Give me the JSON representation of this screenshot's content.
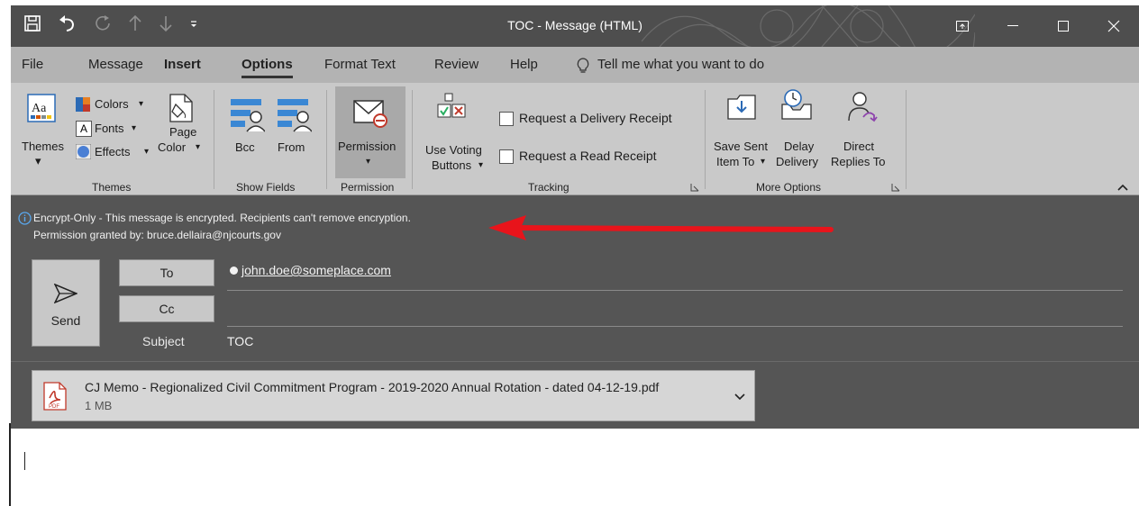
{
  "window": {
    "title": "TOC  -  Message (HTML)"
  },
  "tabs": [
    {
      "label": "File"
    },
    {
      "label": "Message"
    },
    {
      "label": "Insert"
    },
    {
      "label": "Options"
    },
    {
      "label": "Format Text"
    },
    {
      "label": "Review"
    },
    {
      "label": "Help"
    }
  ],
  "tell_me": "Tell me what you want to do",
  "ribbon": {
    "themes": {
      "themes_label": "Themes",
      "colors_label": "Colors",
      "fonts_label": "Fonts",
      "effects_label": "Effects",
      "page_color_label_1": "Page",
      "page_color_label_2": "Color",
      "group_label": "Themes"
    },
    "show_fields": {
      "bcc_label": "Bcc",
      "from_label": "From",
      "group_label": "Show Fields"
    },
    "permission": {
      "permission_label": "Permission",
      "group_label": "Permission"
    },
    "tracking": {
      "voting_label_1": "Use Voting",
      "voting_label_2": "Buttons",
      "delivery_receipt_label": "Request a Delivery Receipt",
      "read_receipt_label": "Request a Read Receipt",
      "group_label": "Tracking"
    },
    "more_options": {
      "save_sent_label_1": "Save Sent",
      "save_sent_label_2": "Item To",
      "delay_label_1": "Delay",
      "delay_label_2": "Delivery",
      "direct_label_1": "Direct",
      "direct_label_2": "Replies To",
      "group_label": "More Options"
    }
  },
  "info_bar": {
    "line1": "Encrypt-Only - This message is encrypted. Recipients can't remove encryption.",
    "line2": "Permission granted by: bruce.dellaira@njcourts.gov"
  },
  "compose": {
    "send_label": "Send",
    "to_label": "To",
    "cc_label": "Cc",
    "subject_label": "Subject",
    "to_value": "john.doe@someplace.com",
    "subject_value": "TOC"
  },
  "attachment": {
    "name": "CJ Memo - Regionalized Civil Commitment Program - 2019-2020 Annual Rotation - dated 04-12-19.pdf",
    "size": "1 MB",
    "icon_text": "PDF"
  },
  "colors": {
    "annotation_arrow": "#e8141b",
    "title_bar": "#4e4e4e",
    "ribbon": "#c9c9c9"
  }
}
